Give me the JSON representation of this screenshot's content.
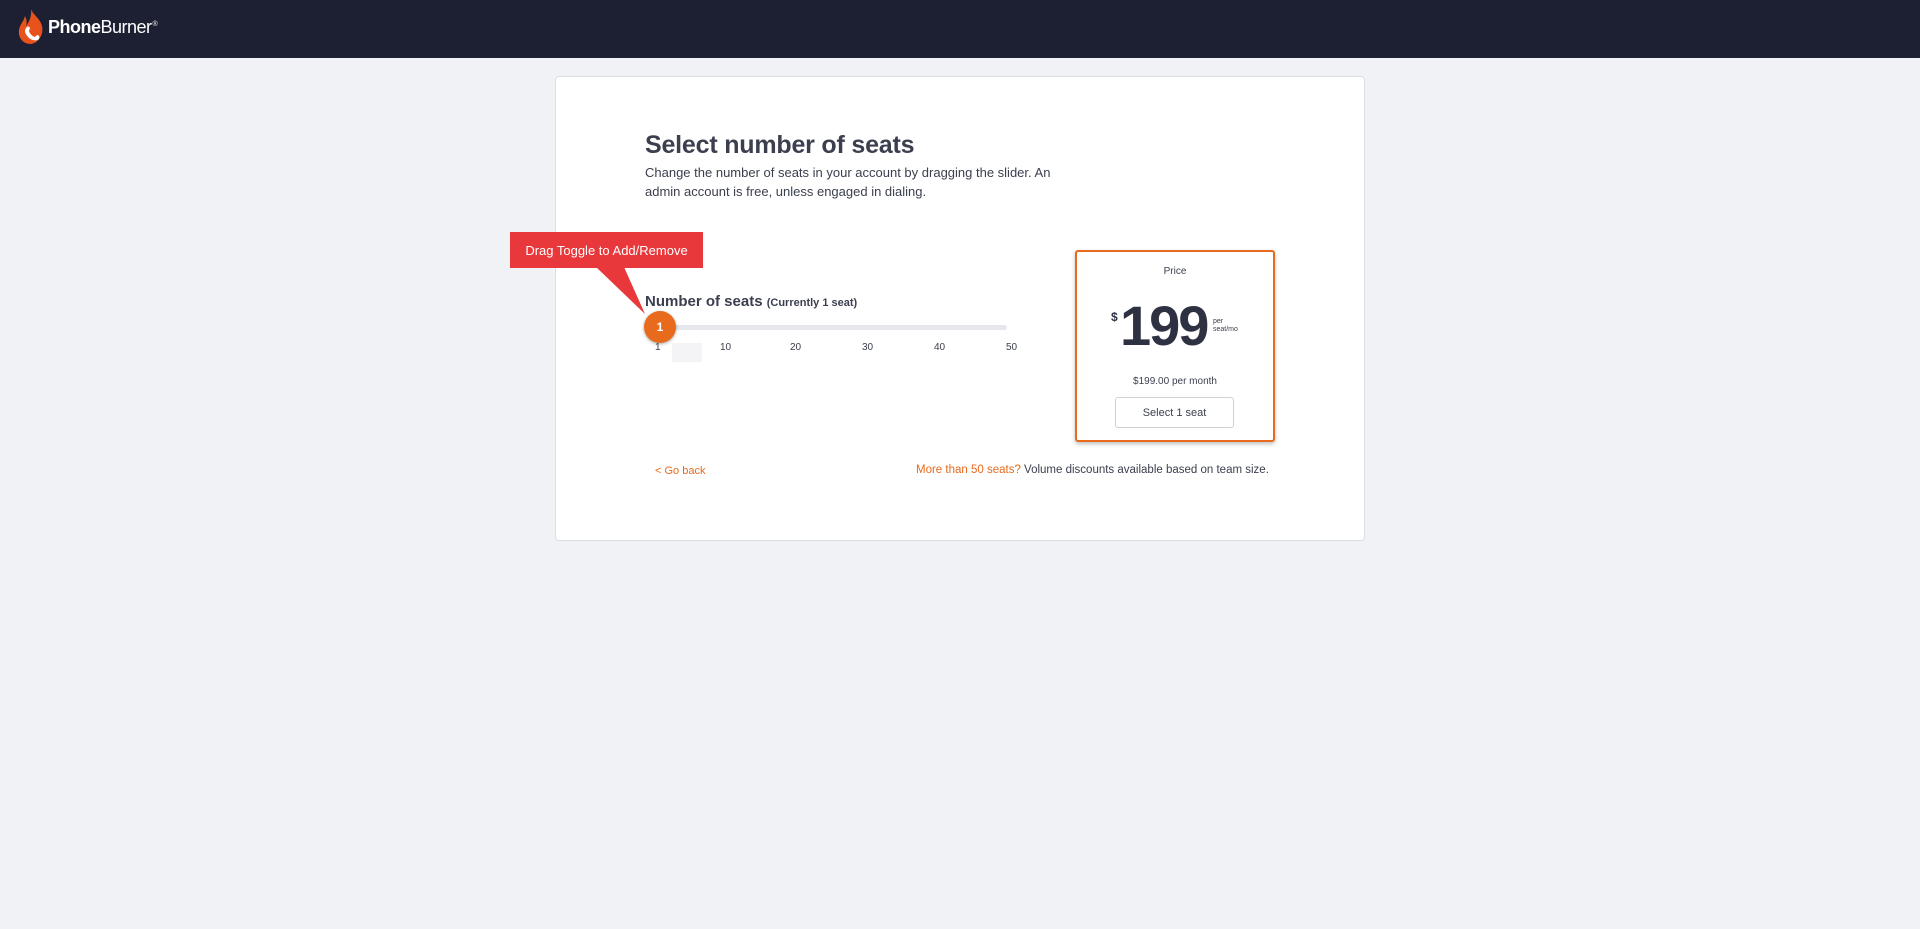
{
  "header": {
    "logo_bold": "Phone",
    "logo_light": "Burner",
    "logo_tm": "®",
    "logo_icon": "flame-phone-icon"
  },
  "main": {
    "title": "Select number of seats",
    "subtitle": "Change the number of seats in your account by dragging the slider. An admin account is free, unless engaged in dialing."
  },
  "tooltip": {
    "text": "Drag Toggle to Add/Remove",
    "color": "#e8383b"
  },
  "slider": {
    "label": "Number of seats",
    "current_label": "(Currently 1 seat)",
    "value": "1",
    "min": 1,
    "max": 50,
    "ticks": [
      "1",
      "10",
      "20",
      "30",
      "40",
      "50"
    ],
    "handle_color": "#e86a1c"
  },
  "price_card": {
    "heading": "Price",
    "currency": "$",
    "amount": "199",
    "unit_line1": "per",
    "unit_line2": "seat/mo",
    "monthly": "$199.00 per month",
    "button_label": "Select 1 seat",
    "border_color": "#e86a1c"
  },
  "footer": {
    "go_back": "< Go back",
    "more_seats_link": "More than 50 seats?",
    "more_seats_text": "Volume discounts available based on team size."
  },
  "colors": {
    "header_bg": "#1d2033",
    "page_bg": "#f1f2f6",
    "accent": "#e86a1c"
  }
}
